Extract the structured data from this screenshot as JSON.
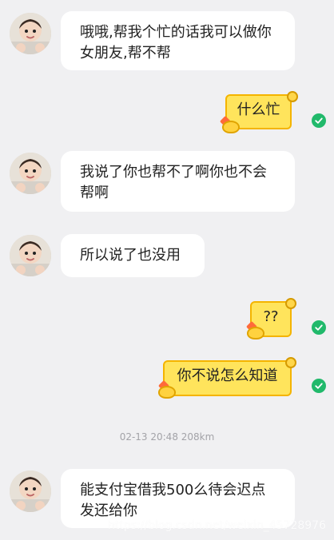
{
  "messages": [
    {
      "type": "incoming",
      "text": "哦哦,帮我个忙的话我可以做你女朋友,帮不帮"
    },
    {
      "type": "outgoing",
      "text": "什么忙"
    },
    {
      "type": "incoming",
      "text": "我说了你也帮不了啊你也不会帮啊"
    },
    {
      "type": "incoming",
      "text": "所以说了也没用"
    },
    {
      "type": "outgoing",
      "text": "??"
    },
    {
      "type": "outgoing",
      "text": "你不说怎么知道"
    },
    {
      "type": "incoming",
      "text": "能支付宝借我500么待会迟点发还给你"
    }
  ],
  "timestamp": "02-13 20:48  208km",
  "watermark": "https://blog.csdn.net/weixin_45728976",
  "colors": {
    "background": "#f0f0f2",
    "incoming_bubble": "#ffffff",
    "outgoing_bubble": "#ffe45c",
    "outgoing_border": "#f4b400",
    "read_check": "#21b96b",
    "timestamp": "#a3a3a8"
  },
  "icons": {
    "avatar": "child-avatar-icon",
    "read": "check-circle-icon",
    "deco": "flower-heart-duck-decoration"
  }
}
